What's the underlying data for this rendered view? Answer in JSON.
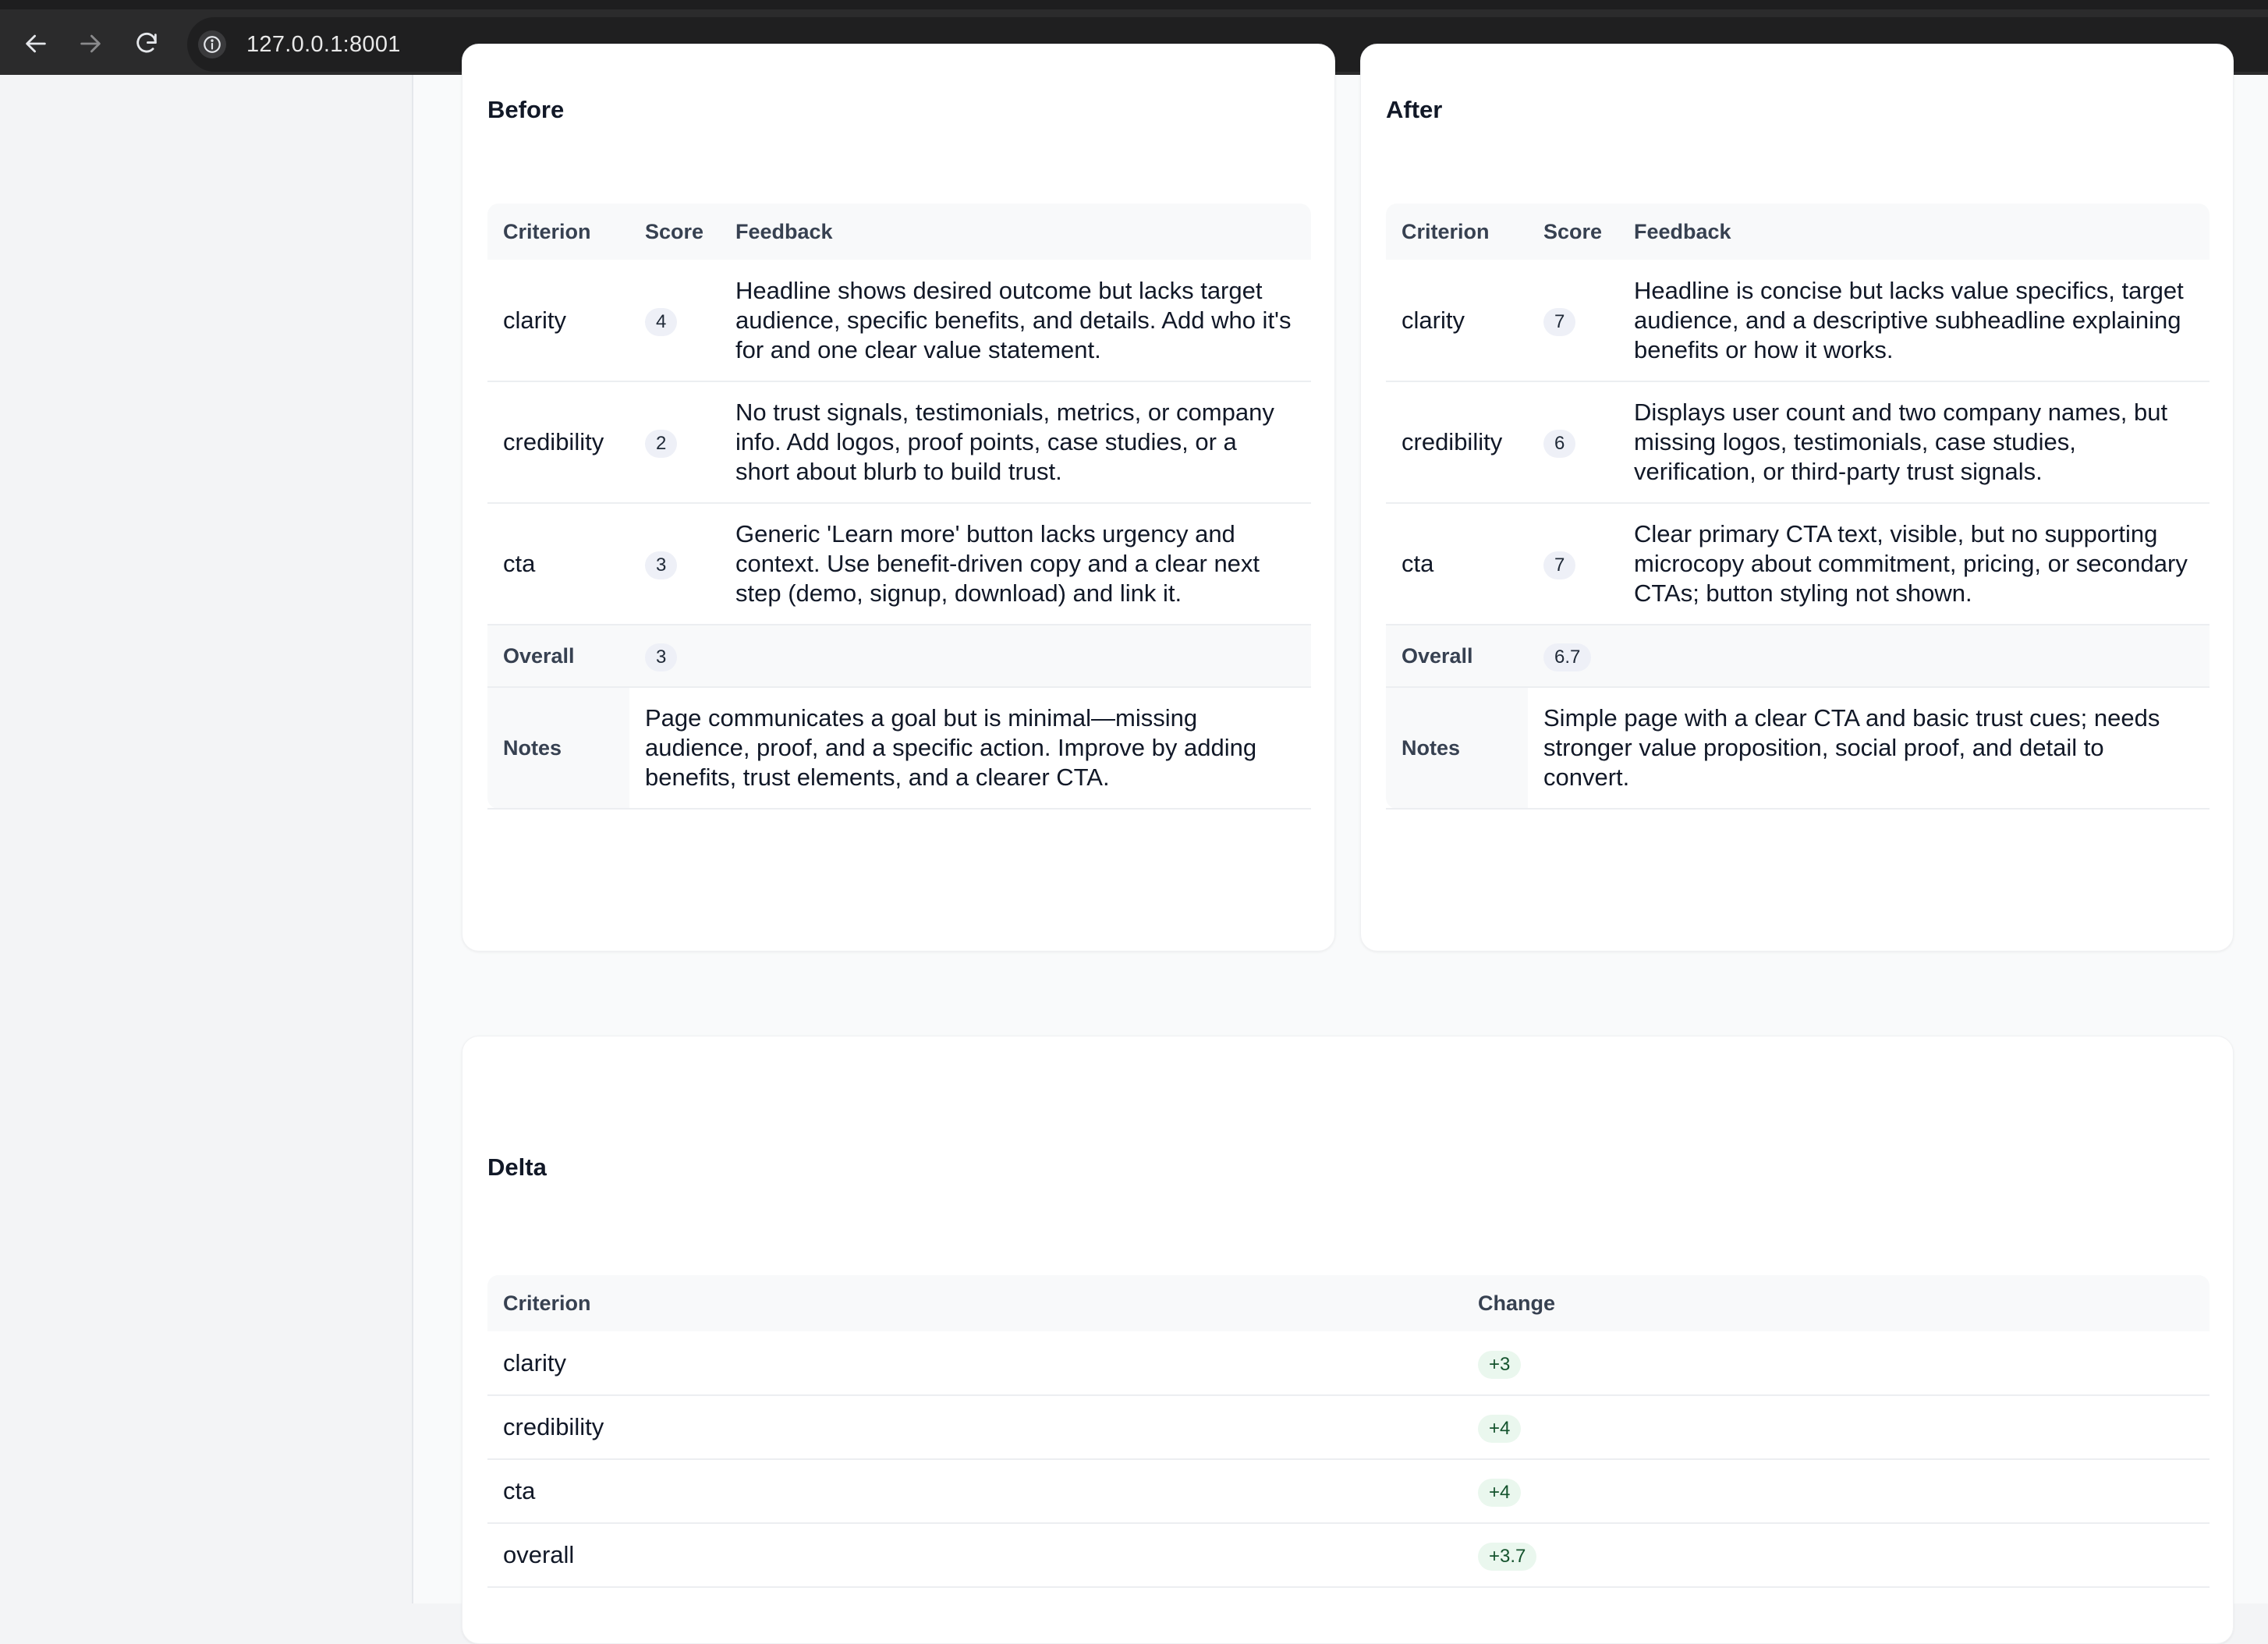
{
  "browser": {
    "url": "127.0.0.1:8001"
  },
  "before": {
    "title": "Before",
    "headers": [
      "Criterion",
      "Score",
      "Feedback"
    ],
    "rows": [
      {
        "criterion": "clarity",
        "score": "4",
        "feedback": "Headline shows desired outcome but lacks target audience, specific benefits, and details. Add who it's for and one clear value statement."
      },
      {
        "criterion": "credibility",
        "score": "2",
        "feedback": "No trust signals, testimonials, metrics, or company info. Add logos, proof points, case studies, or a short about blurb to build trust."
      },
      {
        "criterion": "cta",
        "score": "3",
        "feedback": "Generic 'Learn more' button lacks urgency and context. Use benefit-driven copy and a clear next step (demo, signup, download) and link it."
      }
    ],
    "overall_label": "Overall",
    "overall_score": "3",
    "notes_label": "Notes",
    "notes": "Page communicates a goal but is minimal—missing audience, proof, and a specific action. Improve by adding benefits, trust elements, and a clearer CTA."
  },
  "after": {
    "title": "After",
    "headers": [
      "Criterion",
      "Score",
      "Feedback"
    ],
    "rows": [
      {
        "criterion": "clarity",
        "score": "7",
        "feedback": "Headline is concise but lacks value specifics, target audience, and a descriptive subheadline explaining benefits or how it works."
      },
      {
        "criterion": "credibility",
        "score": "6",
        "feedback": "Displays user count and two company names, but missing logos, testimonials, case studies, verification, or third-party trust signals."
      },
      {
        "criterion": "cta",
        "score": "7",
        "feedback": "Clear primary CTA text, visible, but no supporting microcopy about commitment, pricing, or secondary CTAs; button styling not shown."
      }
    ],
    "overall_label": "Overall",
    "overall_score": "6.7",
    "notes_label": "Notes",
    "notes": "Simple page with a clear CTA and basic trust cues; needs stronger value proposition, social proof, and detail to convert."
  },
  "delta": {
    "title": "Delta",
    "headers": [
      "Criterion",
      "Change"
    ],
    "rows": [
      {
        "criterion": "clarity",
        "change": "+3"
      },
      {
        "criterion": "credibility",
        "change": "+4"
      },
      {
        "criterion": "cta",
        "change": "+4"
      },
      {
        "criterion": "overall",
        "change": "+3.7"
      }
    ]
  }
}
